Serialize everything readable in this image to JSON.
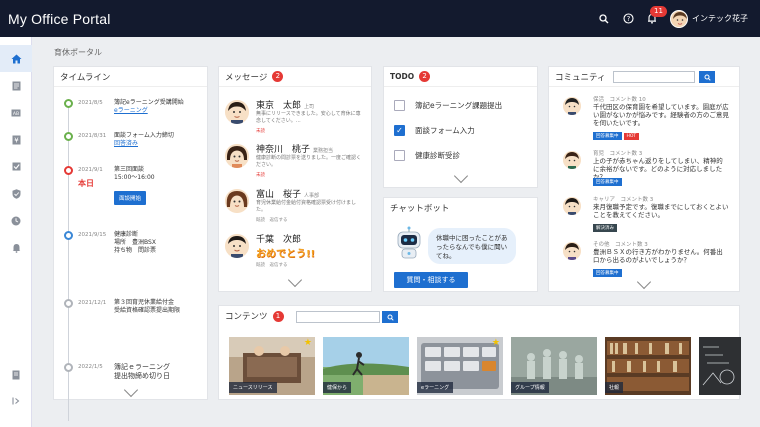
{
  "app": {
    "title": "My Office Portal"
  },
  "topbar": {
    "notification_count": "11",
    "user_name": "インテック花子"
  },
  "breadcrumb": "育休ポータル",
  "timeline": {
    "title": "タイムライン",
    "items": [
      {
        "date": "2021/8/5",
        "text": "簿記eラーニング受講開始",
        "link": "eラーニング"
      },
      {
        "date": "2021/8/31",
        "text": "面談フォーム入力締切",
        "link": "回答済み"
      },
      {
        "date": "2021/9/1",
        "today": "本日",
        "text": "第三回面談",
        "text2": "15:00～16:00",
        "button": "面談開始"
      },
      {
        "date": "2021/9/15",
        "text": "健康診断",
        "text2": "場所　豊洲BSX",
        "text3": "持ち物　問診票"
      },
      {
        "date": "2021/12/1",
        "text": "第３回育児休業給付金",
        "text2": "受給資格確認票提出期限"
      },
      {
        "date": "2022/1/5",
        "text": "簿記ｅラーニング",
        "text2": "提出物締め切り日"
      }
    ]
  },
  "messages": {
    "title": "メッセージ",
    "badge": "2",
    "items": [
      {
        "name": "東京　太郎",
        "role": "上司",
        "body": "無事にリリースできました。安心して育休に専念してください。…",
        "flag": "未読"
      },
      {
        "name": "神奈川　桃子",
        "role": "業務担当",
        "body": "健康診断の問診票を送りました。一度ご確認ください。",
        "flag": "未読"
      },
      {
        "name": "富山　桜子",
        "role": "人事部",
        "body": "育児休業給付金給付資格確認票受け付けました。",
        "flag": "既読　返信する"
      },
      {
        "name": "千葉　次郎",
        "role": "",
        "body": "おめでとう!!",
        "flag": "既読　返信する"
      }
    ]
  },
  "todo": {
    "title": "TODO",
    "badge": "2",
    "items": [
      {
        "label": "簿記eラーニング課題提出",
        "checked": false
      },
      {
        "label": "面談フォーム入力",
        "checked": true
      },
      {
        "label": "健康診断受診",
        "checked": false
      }
    ]
  },
  "chatbot": {
    "title": "チャットボット",
    "bubble": "休職中に困ったことがあったらなんでも僕に聞いてね。",
    "button": "質問・相談する"
  },
  "community": {
    "title": "コミュニティ",
    "items": [
      {
        "meta": "保活　コメント数 10",
        "text": "千代田区の保育園を希望しています。園庭が広い園がないかが悩みです。経験者の方のご意見を伺いたいです。",
        "tags": [
          "回答募集中",
          "HOT"
        ]
      },
      {
        "meta": "育児　コメント数 3",
        "text": "上の子が赤ちゃん返りをしてしまい、精神的に余裕がないです。どのように対応しましたか？",
        "tags": [
          "回答募集中"
        ]
      },
      {
        "meta": "キャリア　コメント数 3",
        "text": "来月復職予定です。復職までにしておくとよいことを教えてください。",
        "tags": [
          "解決済み"
        ]
      },
      {
        "meta": "その他　コメント数 3",
        "text": "豊洲ＢＳＸの行き方がわかりません。何番出口から出るのがよいでしょうか？",
        "tags": [
          "回答募集中"
        ]
      }
    ]
  },
  "contents": {
    "title": "コンテンツ",
    "badge": "1",
    "items": [
      {
        "label": "ニュースリリース",
        "starred": true
      },
      {
        "label": "健保から",
        "starred": false
      },
      {
        "label": "eラーニング",
        "starred": true
      },
      {
        "label": "グループ情報",
        "starred": false
      },
      {
        "label": "社報",
        "starred": false
      },
      {
        "label": "",
        "starred": false
      }
    ]
  },
  "colors": {
    "topbar": "#131a2e",
    "accent": "#1e6fd0",
    "badge": "#e53935",
    "done": "#6ab04c"
  }
}
